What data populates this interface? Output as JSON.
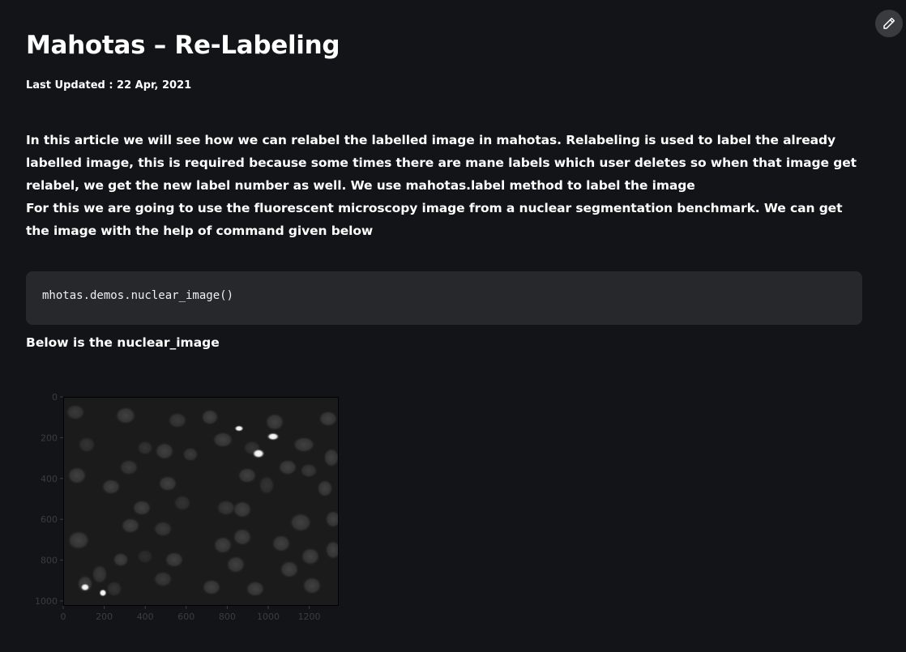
{
  "article": {
    "title": "Mahotas – Re-Labeling",
    "last_updated": "Last Updated : 22 Apr, 2021",
    "paragraph1": "In this article we will see how we can relabel the labelled image in mahotas. Relabeling is used to label the already labelled image, this is required because some times there are mane labels which user deletes so when that image get relabel, we get the new label number as well. We use mahotas.label method to label the image",
    "paragraph2": "For this we are going to use the fluorescent microscopy image from a nuclear segmentation benchmark. We can get the image with the help of command given below",
    "code": "mhotas.demos.nuclear_image()",
    "caption": "Below is the nuclear_image"
  },
  "toolbar": {
    "edit_icon": "pencil-icon"
  },
  "figure": {
    "x_ticks": [
      "0",
      "200",
      "400",
      "600",
      "800",
      "1000",
      "1200"
    ],
    "y_ticks": [
      "0",
      "200",
      "400",
      "600",
      "800",
      "1000"
    ],
    "xlim": [
      0,
      1344
    ],
    "ylim": [
      1024,
      0
    ],
    "colormap": "gray"
  }
}
